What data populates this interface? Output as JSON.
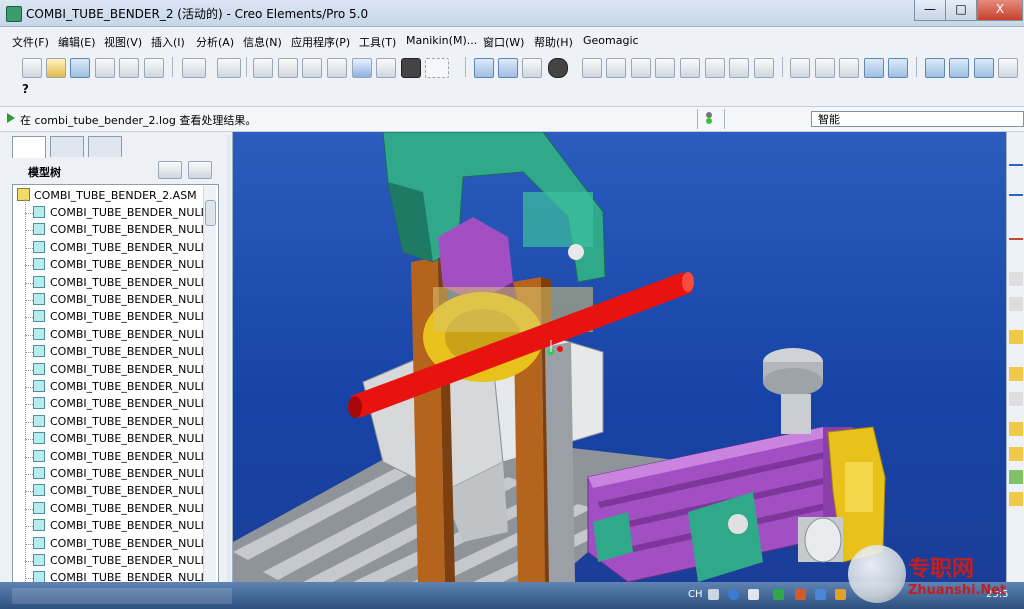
{
  "window": {
    "title": "COMBI_TUBE_BENDER_2 (活动的) - Creo Elements/Pro 5.0",
    "buttons": [
      "—",
      "□",
      "X"
    ]
  },
  "menu": [
    "文件(F)",
    "编辑(E)",
    "视图(V)",
    "插入(I)",
    "分析(A)",
    "信息(N)",
    "应用程序(P)",
    "工具(T)",
    "Manikin(M)...",
    "窗口(W)",
    "帮助(H)",
    "Geomagic"
  ],
  "toolbar_icons": [
    "new-icon",
    "open-icon",
    "save-icon",
    "print-icon",
    "send-icon",
    "model-icon",
    "undo-icon",
    "redo-icon",
    "cut-icon",
    "copy-icon",
    "paste-icon",
    "paste-special-icon",
    "regenerate-icon",
    "find-icon",
    "select-box-icon",
    "repaint-icon",
    "spin-center-icon",
    "orient-icon",
    "shading-icon",
    "pan-icon",
    "zoom-in-icon",
    "zoom-out-icon",
    "refit-icon",
    "saved-views-icon",
    "layers-icon",
    "appearance-icon",
    "wireframe-icon",
    "hidden-line-icon",
    "no-hidden-icon",
    "shaded-icon",
    "enhanced-realism-icon",
    "datum-plane-icon",
    "datum-axis-icon",
    "datum-point-icon",
    "csys-icon",
    "help-context-icon"
  ],
  "message": {
    "text": "在 combi_tube_bender_2.log 查看处理结果。"
  },
  "filter": {
    "value": "智能"
  },
  "left_panel": {
    "tabs": [
      "model-tree-tab",
      "folder-browser-tab",
      "favorites-tab"
    ],
    "header": "模型树",
    "root": "COMBI_TUBE_BENDER_2.ASM",
    "items": [
      "COMBI_TUBE_BENDER_NULL",
      "COMBI_TUBE_BENDER_NULL",
      "COMBI_TUBE_BENDER_NULL",
      "COMBI_TUBE_BENDER_NULL",
      "COMBI_TUBE_BENDER_NULL",
      "COMBI_TUBE_BENDER_NULL",
      "COMBI_TUBE_BENDER_NULL",
      "COMBI_TUBE_BENDER_NULL",
      "COMBI_TUBE_BENDER_NULL",
      "COMBI_TUBE_BENDER_NULL",
      "COMBI_TUBE_BENDER_NULL",
      "COMBI_TUBE_BENDER_NULL",
      "COMBI_TUBE_BENDER_NULL",
      "COMBI_TUBE_BENDER_NULL",
      "COMBI_TUBE_BENDER_NULL",
      "COMBI_TUBE_BENDER_NULL",
      "COMBI_TUBE_BENDER_NULL",
      "COMBI_TUBE_BENDER_NULL",
      "COMBI_TUBE_BENDER_NULL",
      "COMBI_TUBE_BENDER_NULL",
      "COMBI_TUBE_BENDER_NULL",
      "COMBI_TUBE_BENDER_NULL",
      "COMBI_TUBE_BENDER_NULL"
    ]
  },
  "taskbar": {
    "lang": "CH",
    "clock": "23:5"
  },
  "watermark": {
    "line1": "专职网",
    "line2": "Zhuanshi.Net"
  },
  "colors": {
    "viewport_bg": "#1d48a8",
    "tube": "#e8120f",
    "frame_teal": "#2fa98a",
    "clamp_purple": "#a24fc4",
    "post_wood": "#b5641e",
    "base_gray": "#b5b9bd",
    "accent_yellow": "#e8c21a"
  }
}
